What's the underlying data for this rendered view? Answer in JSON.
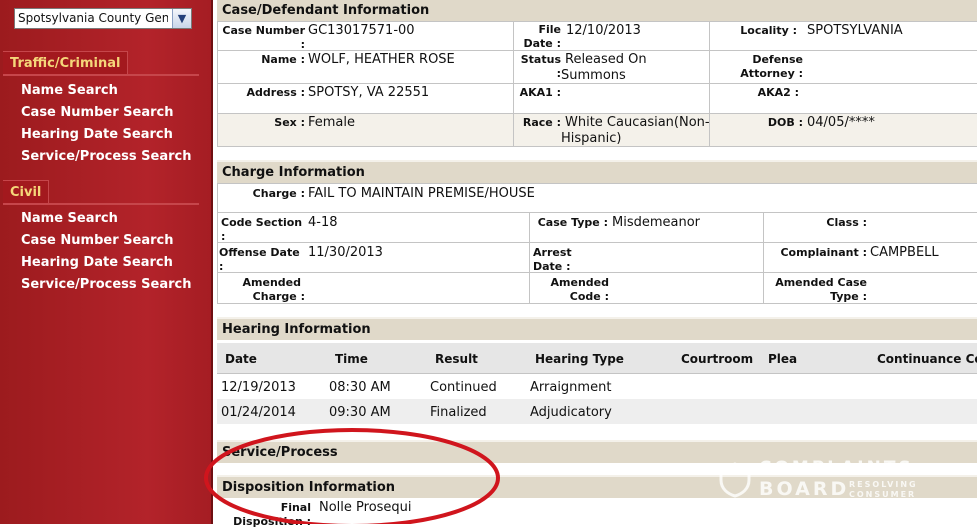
{
  "sidebar": {
    "court_select": "Spotsylvania County Gen",
    "sections": [
      {
        "title": "Traffic/Criminal",
        "items": [
          "Name Search",
          "Case Number Search",
          "Hearing Date Search",
          "Service/Process Search"
        ]
      },
      {
        "title": "Civil",
        "items": [
          "Name Search",
          "Case Number Search",
          "Hearing Date Search",
          "Service/Process Search"
        ]
      }
    ]
  },
  "case": {
    "header": "Case/Defendant Information",
    "case_number_label": "Case Number :",
    "case_number": "GC13017571-00",
    "file_date_label_1": "File",
    "file_date_label_2": "Date :",
    "file_date": "12/10/2013",
    "locality_label": "Locality :",
    "locality": "SPOTSYLVANIA",
    "name_label": "Name :",
    "name": "WOLF, HEATHER ROSE",
    "status_label": "Status :",
    "status_1": "Released On",
    "status_2": "Summons",
    "defense_label_1": "Defense",
    "defense_label_2": "Attorney :",
    "address_label": "Address :",
    "address": "SPOTSY, VA 22551",
    "aka1_label": "AKA1 :",
    "aka2_label": "AKA2 :",
    "sex_label": "Sex :",
    "sex": "Female",
    "race_label": "Race :",
    "race_1": "White Caucasian(Non-",
    "race_2": "Hispanic)",
    "dob_label": "DOB :",
    "dob": "04/05/****"
  },
  "charge": {
    "header": "Charge Information",
    "charge_label": "Charge :",
    "charge": "FAIL TO MAINTAIN PREMISE/HOUSE",
    "code_section_label": "Code Section :",
    "code_section": "4-18",
    "case_type_label": "Case Type :",
    "case_type": "Misdemeanor",
    "class_label": "Class :",
    "offense_date_label": "Offense Date :",
    "offense_date": "11/30/2013",
    "arrest_date_label": "Arrest Date :",
    "complainant_label": "Complainant :",
    "complainant": "CAMPBELL",
    "amended_charge_label_1": "Amended",
    "amended_charge_label_2": "Charge :",
    "amended_code_label_1": "Amended",
    "amended_code_label_2": "Code :",
    "amended_case_type_label_1": "Amended Case",
    "amended_case_type_label_2": "Type :"
  },
  "hearing": {
    "header": "Hearing Information",
    "columns": [
      "Date",
      "Time",
      "Result",
      "Hearing Type",
      "Courtroom",
      "Plea",
      "Continuance Co"
    ],
    "rows": [
      [
        "12/19/2013",
        "08:30 AM",
        "Continued",
        "Arraignment"
      ],
      [
        "01/24/2014",
        "09:30 AM",
        "Finalized",
        "Adjudicatory"
      ]
    ]
  },
  "service": {
    "header": "Service/Process"
  },
  "disposition": {
    "header": "Disposition Information",
    "final_label_1": "Final",
    "final_label_2": "Disposition :",
    "final": "Nolle Prosequi"
  },
  "watermark": {
    "line1": "COMPLAINTS",
    "line2": "BOARD",
    "tag1": "RESOLVING",
    "tag2": "CONSUMER"
  },
  "colors": {
    "sidebar_red": "#b3232a",
    "tab_text_gold": "#f5d77a",
    "section_header_tan": "#e0d9c9",
    "annotation_circle_red": "#d0151d"
  }
}
